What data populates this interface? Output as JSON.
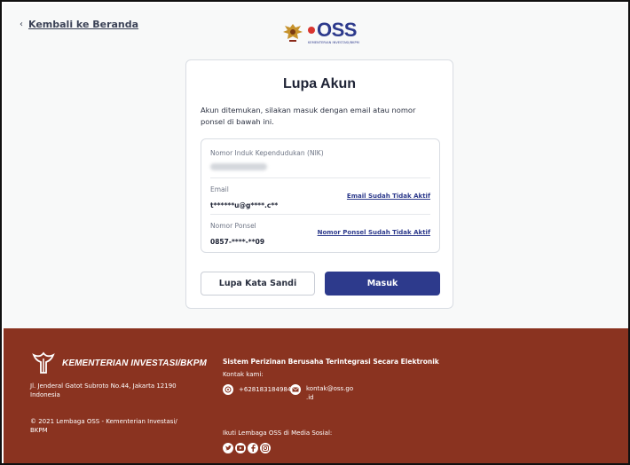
{
  "nav": {
    "back_label": "Kembali ke Beranda"
  },
  "brand": {
    "oss_word": "OSS",
    "tagline": "KEMENTERIAN INVESTASI/BKPM"
  },
  "card": {
    "title": "Lupa Akun",
    "description": "Akun ditemukan, silakan masuk dengan email atau nomor ponsel di bawah ini.",
    "fields": [
      {
        "label": "Nomor Induk Kependudukan (NIK)",
        "value": "",
        "link": ""
      },
      {
        "label": "Email",
        "value": "t******u@g****.c**",
        "link": "Email Sudah Tidak Aktif"
      },
      {
        "label": "Nomor Ponsel",
        "value": "0857-****-**09",
        "link": "Nomor Ponsel Sudah Tidak Aktif"
      }
    ],
    "buttons": {
      "secondary": "Lupa Kata Sandi",
      "primary": "Masuk"
    }
  },
  "footer": {
    "ministry": "KEMENTERIAN INVESTASI/BKPM",
    "address": "Jl. Jenderal Gatot Subroto No.44, Jakarta 12190",
    "country": "Indonesia",
    "copyright": "© 2021 Lembaga OSS - Kementerian Investasi/ BKPM",
    "system_name": "Sistem Perizinan Berusaha Terintegrasi Secara Elektronik",
    "contact_label": "Kontak kami:",
    "phone": "+628183184984",
    "email_line1": "kontak@oss.go",
    "email_line2": ".id",
    "social_label": "Ikuti Lembaga OSS di Media Sosial:",
    "social_icons": [
      "twitter-icon",
      "youtube-icon",
      "facebook-icon",
      "instagram-icon"
    ]
  },
  "colors": {
    "primary": "#2d3a8c",
    "footer_bg": "#8a3320",
    "page_bg": "#f8f9f9"
  }
}
